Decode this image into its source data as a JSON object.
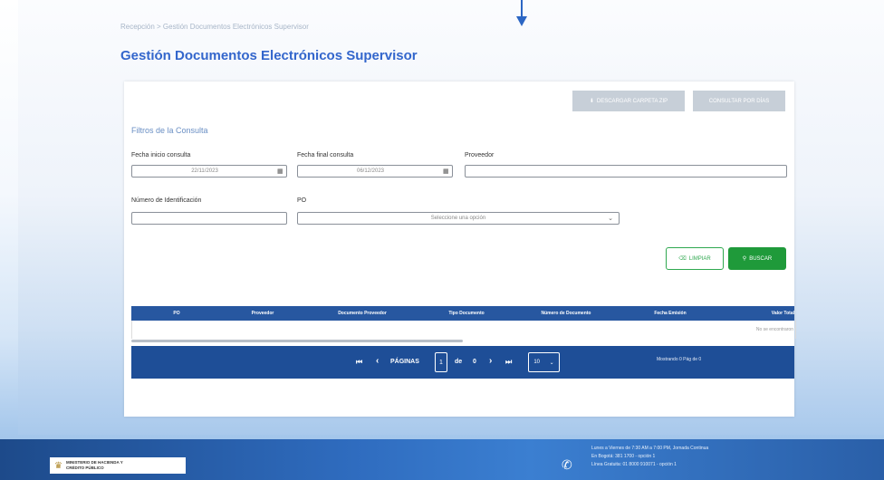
{
  "breadcrumb": "Recepción > Gestión Documentos Electrónicos Supervisor",
  "page_title": "Gestión Documentos Electrónicos Supervisor",
  "toolbar": {
    "download_label": "DESCARGAR CARPETA ZIP",
    "query_label": "CONSULTAR POR DÍAS"
  },
  "filters": {
    "section_title": "Filtros de la Consulta",
    "start_date_label": "Fecha inicio consulta",
    "start_date_value": "22/11/2023",
    "end_date_label": "Fecha final consulta",
    "end_date_value": "06/12/2023",
    "provider_label": "Proveedor",
    "provider_value": "",
    "id_number_label": "Número de Identificación",
    "id_number_value": "",
    "po_label": "PO",
    "po_value": "Seleccione una opción"
  },
  "actions": {
    "clear_label": "LIMPIAR",
    "search_label": "BUSCAR"
  },
  "table": {
    "columns": [
      "PO",
      "Proveedor",
      "Documento Proveedor",
      "Tipo Documento",
      "Número de Documento",
      "Fecha Emisión",
      "Valor Total"
    ],
    "empty_text": "No se encontraron"
  },
  "pager": {
    "first": "⏮",
    "prev": "‹",
    "pages_label": "PÁGINAS",
    "current_page": "1",
    "of_label": "de",
    "total_pages": "0",
    "next": "›",
    "last": "⏭",
    "page_size": "10",
    "range_text": "Mostrando 0 Pág de 0"
  },
  "footer": {
    "ministry_line1": "MINISTERIO DE HACIENDA Y",
    "ministry_line2": "CRÉDITO PÚBLICO",
    "contact_line1": "Lunes a Viernes de 7:30 AM a 7:00 PM, Jornada Continua",
    "contact_line2": "En Bogotá: 381 1700 - opción 1",
    "contact_line3": "Línea Gratuita: 01 8000 910071 - opción 1"
  },
  "colors": {
    "title_blue": "#3366cc",
    "table_header": "#2757a0",
    "pager": "#1e4e97",
    "success": "#1f9a3a"
  }
}
